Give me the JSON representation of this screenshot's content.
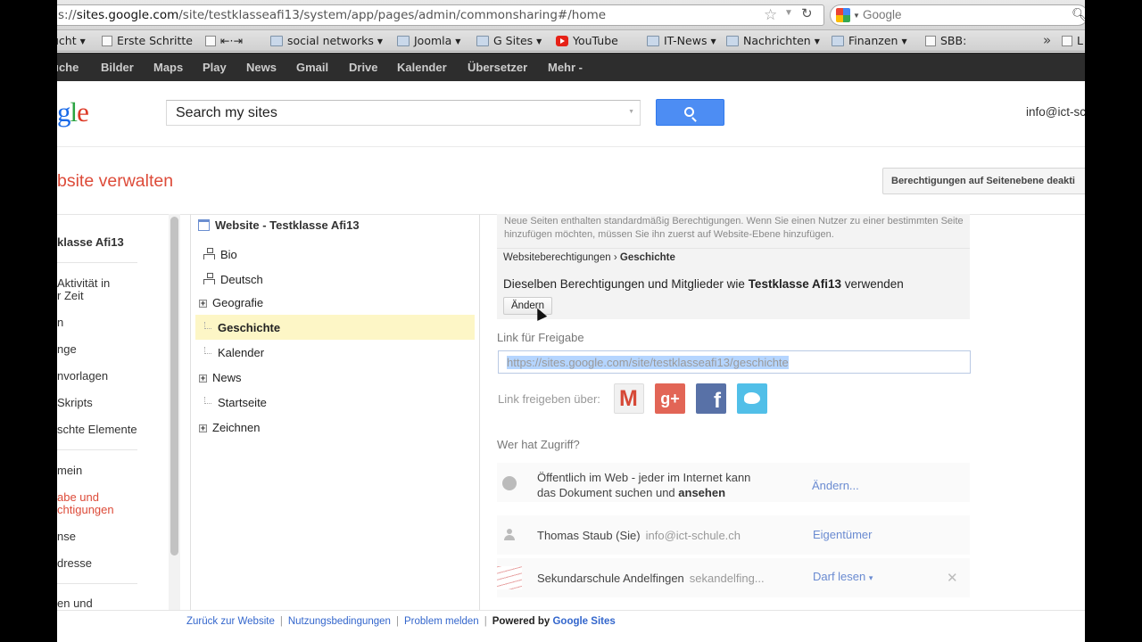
{
  "browser": {
    "url_prefix": "s://",
    "url_domain": "sites.google.com",
    "url_path": "/site/testklasseafi13/system/app/pages/admin/commonsharing#/home",
    "search_placeholder": "Google"
  },
  "bookmarks": [
    {
      "label": "ucht",
      "icon": "none",
      "dropdown": true
    },
    {
      "label": "Erste Schritte",
      "icon": "page",
      "dropdown": false
    },
    {
      "label": "⇤·⇥",
      "icon": "page",
      "dropdown": false
    },
    {
      "label": "social networks",
      "icon": "folder",
      "dropdown": true
    },
    {
      "label": "Joomla",
      "icon": "folder",
      "dropdown": true
    },
    {
      "label": "G Sites",
      "icon": "folder",
      "dropdown": true
    },
    {
      "label": "YouTube",
      "icon": "youtube",
      "dropdown": false
    },
    {
      "label": "IT-News",
      "icon": "folder",
      "dropdown": true
    },
    {
      "label": "Nachrichten",
      "icon": "folder",
      "dropdown": true
    },
    {
      "label": "Finanzen",
      "icon": "folder",
      "dropdown": true
    },
    {
      "label": "SBB:",
      "icon": "page",
      "dropdown": false
    }
  ],
  "bookmarks_overflow": "»",
  "bookmarks_last": "L",
  "google_bar": [
    "uche",
    "Bilder",
    "Maps",
    "Play",
    "News",
    "Gmail",
    "Drive",
    "Kalender",
    "Übersetzer",
    "Mehr -"
  ],
  "header": {
    "logo_parts": [
      "g",
      "l",
      "e"
    ],
    "search_placeholder": "Search my sites",
    "account": "info@ict-sc"
  },
  "page": {
    "title": "bsite verwalten",
    "perm_button": "Berechtigungen auf Seitenebene deakti"
  },
  "left_nav": {
    "site_name": "klasse Afi13",
    "items": [
      "Aktivität in",
      "r Zeit",
      "n",
      "nge",
      "nvorlagen",
      "Skripts",
      "schte Elemente",
      "mein",
      "abe und",
      "chtigungen",
      "nse",
      "dresse",
      "en und"
    ]
  },
  "tree": {
    "root": "Website - Testklasse Afi13",
    "items": [
      {
        "label": "Bio",
        "kind": "network"
      },
      {
        "label": "Deutsch",
        "kind": "network"
      },
      {
        "label": "Geografie",
        "kind": "expand"
      },
      {
        "label": "Geschichte",
        "kind": "leaf",
        "selected": true
      },
      {
        "label": "Kalender",
        "kind": "leaf"
      },
      {
        "label": "News",
        "kind": "expand"
      },
      {
        "label": "Startseite",
        "kind": "leaf"
      },
      {
        "label": "Zeichnen",
        "kind": "expand"
      }
    ]
  },
  "content": {
    "info": "Neue Seiten enthalten standardmäßig Berechtigungen. Wenn Sie einen Nutzer zu einer bestimmten Seite hinzufügen möchten, müssen Sie ihn zuerst auf Website-Ebene hinzufügen.",
    "crumb_parent": "Websiteberechtigungen",
    "crumb_sep": "›",
    "crumb_current": "Geschichte",
    "same_perm_pre": "Dieselben Berechtigungen und Mitglieder wie",
    "same_perm_site": "Testklasse Afi13",
    "same_perm_post": "verwenden",
    "change_button": "Ändern",
    "link_label": "Link für Freigabe",
    "link_url": "https://sites.google.com/site/testklasseafi13/geschichte",
    "share_label": "Link freigeben über:",
    "share_gplus": "g+",
    "share_fb": "f",
    "access_label": "Wer hat Zugriff?",
    "access": [
      {
        "line1": "Öffentlich im Web - jeder im Internet kann",
        "line2_pre": "das Dokument suchen und",
        "line2_bold": "ansehen",
        "role": "Ändern..."
      },
      {
        "name": "Thomas Staub (Sie)",
        "email": "info@ict-schule.ch",
        "role": "Eigentümer"
      },
      {
        "name": "Sekundarschule Andelfingen",
        "email": "sekandelfing...",
        "role": "Darf lesen",
        "role_arrow": "▾",
        "remove": "✕"
      }
    ]
  },
  "footer": {
    "links": [
      "Zurück zur Website",
      "Nutzungsbedingungen",
      "Problem melden"
    ],
    "sep": "|",
    "powered_pre": "Powered by",
    "powered_link": "Google Sites"
  }
}
